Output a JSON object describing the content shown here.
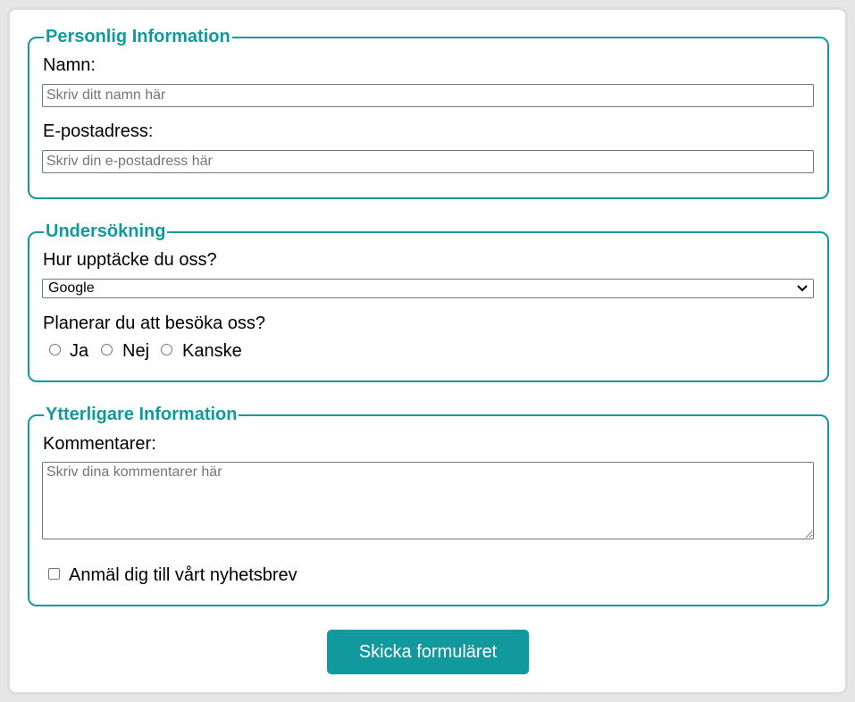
{
  "personal": {
    "legend": "Personlig Information",
    "name_label": "Namn:",
    "name_placeholder": "Skriv ditt namn här",
    "email_label": "E-postadress:",
    "email_placeholder": "Skriv din e-postadress här"
  },
  "survey": {
    "legend": "Undersökning",
    "source_label": "Hur upptäcke du oss?",
    "source_selected": "Google",
    "visit_label": "Planerar du att besöka oss?",
    "visit_options": [
      "Ja",
      "Nej",
      "Kanske"
    ]
  },
  "additional": {
    "legend": "Ytterligare Information",
    "comments_label": "Kommentarer:",
    "comments_placeholder": "Skriv dina kommentarer här",
    "newsletter_label": "Anmäl dig till vårt nyhetsbrev"
  },
  "submit_label": "Skicka formuläret",
  "colors": {
    "accent": "#11999e",
    "background": "#e6e6e6",
    "card": "#ffffff"
  }
}
